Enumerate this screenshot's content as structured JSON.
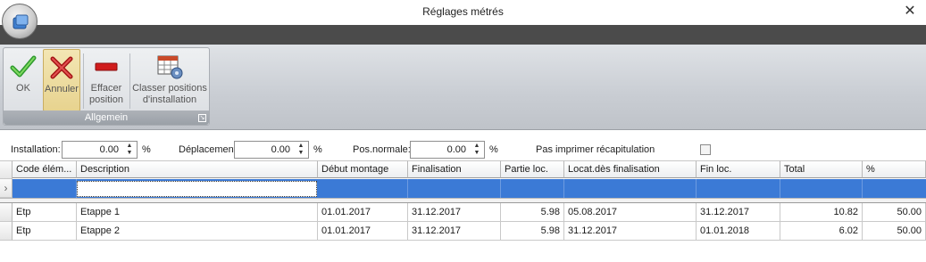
{
  "window": {
    "title": "Réglages métrés",
    "close_glyph": "✕"
  },
  "ribbon": {
    "group_label": "Allgemein",
    "buttons": [
      {
        "icon": "check-icon",
        "label_lines": [
          "OK"
        ]
      },
      {
        "icon": "cross-icon",
        "label_lines": [
          "Annuler"
        ]
      },
      {
        "icon": "minus-icon",
        "label_lines": [
          "Effacer",
          "position"
        ]
      },
      {
        "icon": "table-settings-icon",
        "label_lines": [
          "Classer positions",
          "d'installation"
        ]
      }
    ]
  },
  "fields": {
    "installation": {
      "label": "Installation:",
      "value": "0.00",
      "unit": "%"
    },
    "deplacement": {
      "label": "Déplacement",
      "value": "0.00",
      "unit": "%"
    },
    "pos_normale": {
      "label": "Pos.normale:",
      "value": "0.00",
      "unit": "%"
    },
    "no_print": {
      "label": "Pas imprimer récapitulation",
      "checked": false
    }
  },
  "grid": {
    "columns": [
      "Code élém...",
      "Description",
      "Début montage",
      "Finalisation",
      "Partie loc.",
      "Locat.dès finalisation",
      "Fin loc.",
      "Total",
      "%"
    ],
    "new_row_indicator": "›",
    "rows": [
      [
        "Etp",
        "Etappe 1",
        "01.01.2017",
        "31.12.2017",
        "5.98",
        "05.08.2017",
        "31.12.2017",
        "10.82",
        "50.00"
      ],
      [
        "Etp",
        "Etappe 2",
        "01.01.2017",
        "31.12.2017",
        "5.98",
        "31.12.2017",
        "01.01.2018",
        "6.02",
        "50.00"
      ]
    ]
  }
}
